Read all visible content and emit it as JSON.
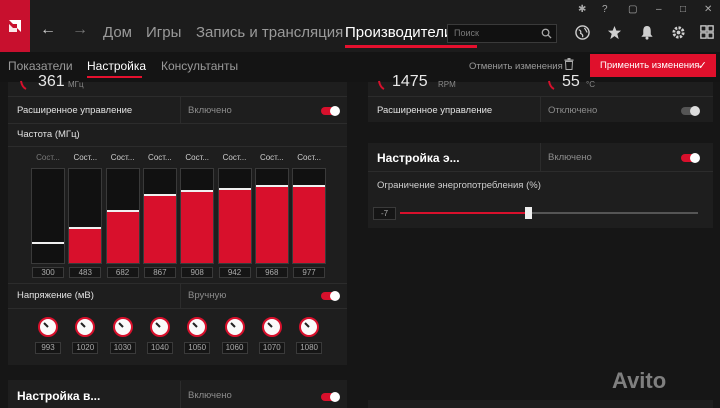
{
  "nav": {
    "items": [
      "Дом",
      "Игры",
      "Запись и трансляция",
      "Производители"
    ],
    "search_placeholder": "Поиск"
  },
  "subnav": {
    "tabs": [
      "Показатели",
      "Настройка",
      "Консультанты"
    ],
    "revert_label": "Отменить изменения",
    "apply_label": "Применить изменения"
  },
  "gpu_panel": {
    "clock_value": "361",
    "clock_unit": "МГц",
    "advanced_label": "Расширенное управление",
    "advanced_state": "Включено",
    "advanced_on": true,
    "freq_label": "Частота (МГц)",
    "state_labels": [
      "Сост...",
      "Сост...",
      "Сост...",
      "Сост...",
      "Сост...",
      "Сост...",
      "Сост...",
      "Сост..."
    ],
    "freq_values": [
      "300",
      "483",
      "682",
      "867",
      "908",
      "942",
      "968",
      "977"
    ],
    "voltage_label": "Напряжение (мВ)",
    "voltage_mode": "Вручную",
    "voltage_on": true,
    "voltage_values": [
      "993",
      "1020",
      "1030",
      "1040",
      "1050",
      "1060",
      "1070",
      "1080"
    ],
    "bottom_title": "Настройка в...",
    "bottom_state": "Включено"
  },
  "fan_panel": {
    "rpm_value": "1475",
    "rpm_unit": "RPM",
    "temp_value": "55",
    "temp_unit": "°C",
    "advanced_label": "Расширенное управление",
    "advanced_state": "Отключено",
    "advanced_on": false
  },
  "power_panel": {
    "title": "Настройка э...",
    "state": "Включено",
    "enabled": true,
    "limit_label": "Ограничение энергопотребления (%)",
    "limit_value": "-7",
    "limit_min": -50,
    "limit_max": 50
  },
  "watermark": "Avito",
  "colors": {
    "accent": "#e0102c",
    "background": "#161616",
    "panel": "#1e1e1e"
  }
}
